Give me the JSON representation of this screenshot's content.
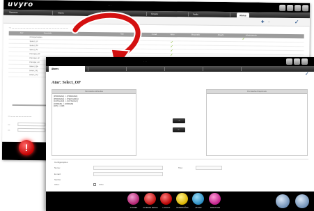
{
  "back_window": {
    "logo": "uvyro",
    "menu_items": [
      "Sistemas",
      "Atores",
      "Permissões",
      "Grupos",
      "Perfis",
      "Atores/Perfis"
    ],
    "active_tab": "Atores",
    "grid_headers": [
      "Ator",
      "Descrição",
      "Tipo",
      "E-mail",
      "Ativo",
      "Bloqueado",
      "Ativado",
      "Administrador"
    ],
    "rows": [
      "Principal Admin",
      "Select_UF",
      "Select_OP",
      "Select_AV",
      "Principal_OP",
      "Principal_UF",
      "Principal_AV",
      "Select_QA",
      "Select_RE",
      "Select_GU"
    ]
  },
  "front_window": {
    "logo": "uvyro",
    "active_tab": "Atores",
    "title": "Ator: Select_OP",
    "left_panel_header": "Permissões Atribuídas",
    "left_lines": [
      "[PRIMARIA] -> [PRIMARIA]",
      "[PRIMARIA] -> [TERCIARIA]",
      "[COTACAO] -> [COTACAO]",
      "[ORDEM] -> [ORDEM]",
      "[OP] -> [OP]"
    ],
    "right_panel_header": "Permissões Disponíveis",
    "move_right": "→",
    "move_left": "←",
    "section_label": "Configurações",
    "fields": {
      "name_label": "Nome:",
      "type_label": "Tipo:",
      "email_label": "E-mail:",
      "password_label": "Senha:",
      "active_label": "Ativo:",
      "active_value": "Ativo"
    },
    "bottom_actions": [
      "ATORES",
      "ALTERAR SENHA",
      "LOGOUT",
      "PERMISSÕES",
      "ATIVAR",
      "DESATIVAR"
    ]
  },
  "colors": {
    "accent_dark": "#0a3b7a",
    "alert_red": "#c40000",
    "arrow_red": "#d41010",
    "check_green": "#7ab51d"
  }
}
